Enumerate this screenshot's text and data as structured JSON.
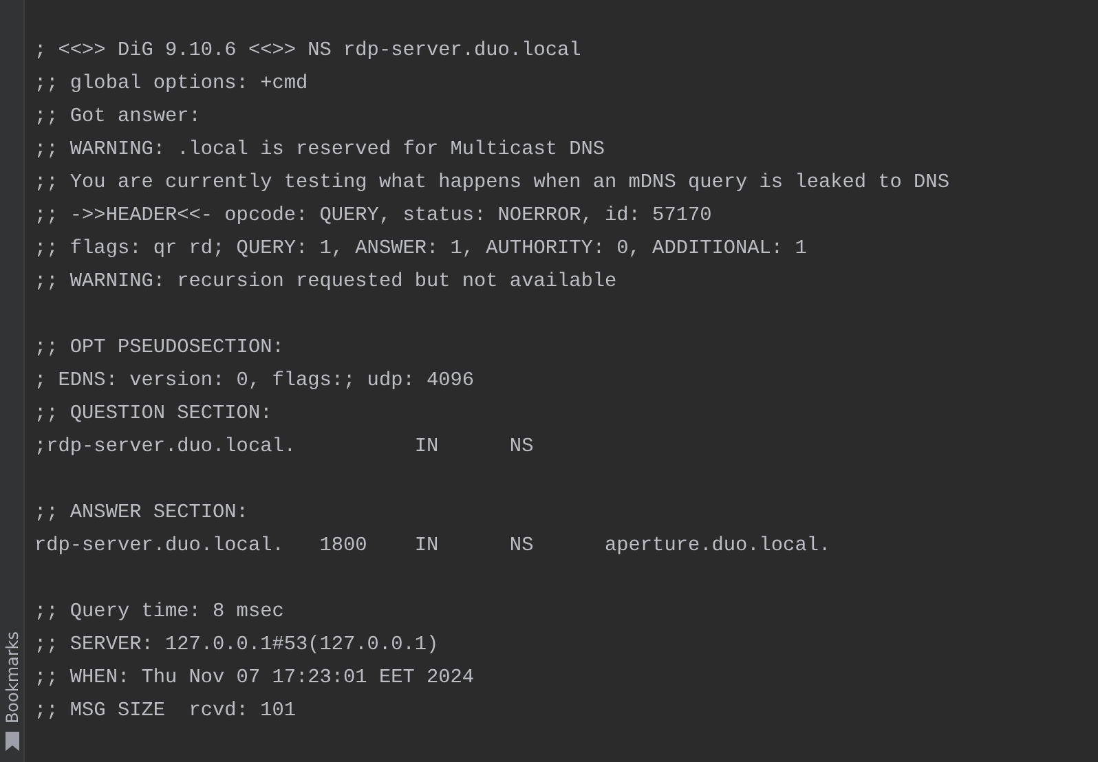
{
  "side_strip": {
    "label": "Bookmarks"
  },
  "output_blocks": [
    [
      "; <<>> DiG 9.10.6 <<>> NS rdp-server.duo.local",
      ";; global options: +cmd",
      ";; Got answer:",
      ";; WARNING: .local is reserved for Multicast DNS",
      ";; You are currently testing what happens when an mDNS query is leaked to DNS",
      ";; ->>HEADER<<- opcode: QUERY, status: NOERROR, id: 57170",
      ";; flags: qr rd; QUERY: 1, ANSWER: 1, AUTHORITY: 0, ADDITIONAL: 1",
      ";; WARNING: recursion requested but not available"
    ],
    [
      ";; OPT PSEUDOSECTION:",
      "; EDNS: version: 0, flags:; udp: 4096",
      ";; QUESTION SECTION:",
      ";rdp-server.duo.local.          IN      NS"
    ],
    [
      ";; ANSWER SECTION:",
      "rdp-server.duo.local.   1800    IN      NS      aperture.duo.local."
    ],
    [
      ";; Query time: 8 msec",
      ";; SERVER: 127.0.0.1#53(127.0.0.1)",
      ";; WHEN: Thu Nov 07 17:23:01 EET 2024",
      ";; MSG SIZE  rcvd: 101"
    ]
  ]
}
